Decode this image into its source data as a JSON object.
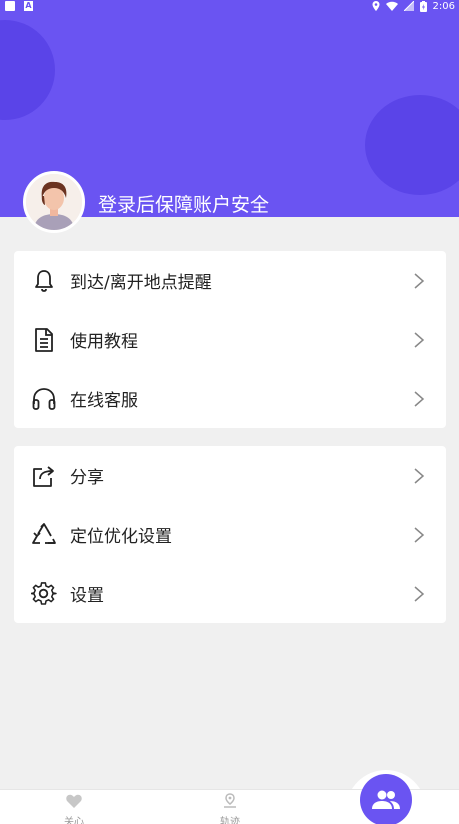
{
  "status_bar": {
    "time": "2:06"
  },
  "header": {
    "login_prompt": "登录后保障账户安全",
    "accent_color": "#6a54f2"
  },
  "menu_group_1": [
    {
      "label": "到达/离开地点提醒",
      "icon": "bell-icon"
    },
    {
      "label": "使用教程",
      "icon": "document-icon"
    },
    {
      "label": "在线客服",
      "icon": "headphones-icon"
    }
  ],
  "menu_group_2": [
    {
      "label": "分享",
      "icon": "share-icon"
    },
    {
      "label": "定位优化设置",
      "icon": "recycle-icon"
    },
    {
      "label": "设置",
      "icon": "gear-icon"
    }
  ],
  "bottom_nav": {
    "care_label": "关心",
    "track_label": "轨迹",
    "friends_icon": "people-icon"
  }
}
